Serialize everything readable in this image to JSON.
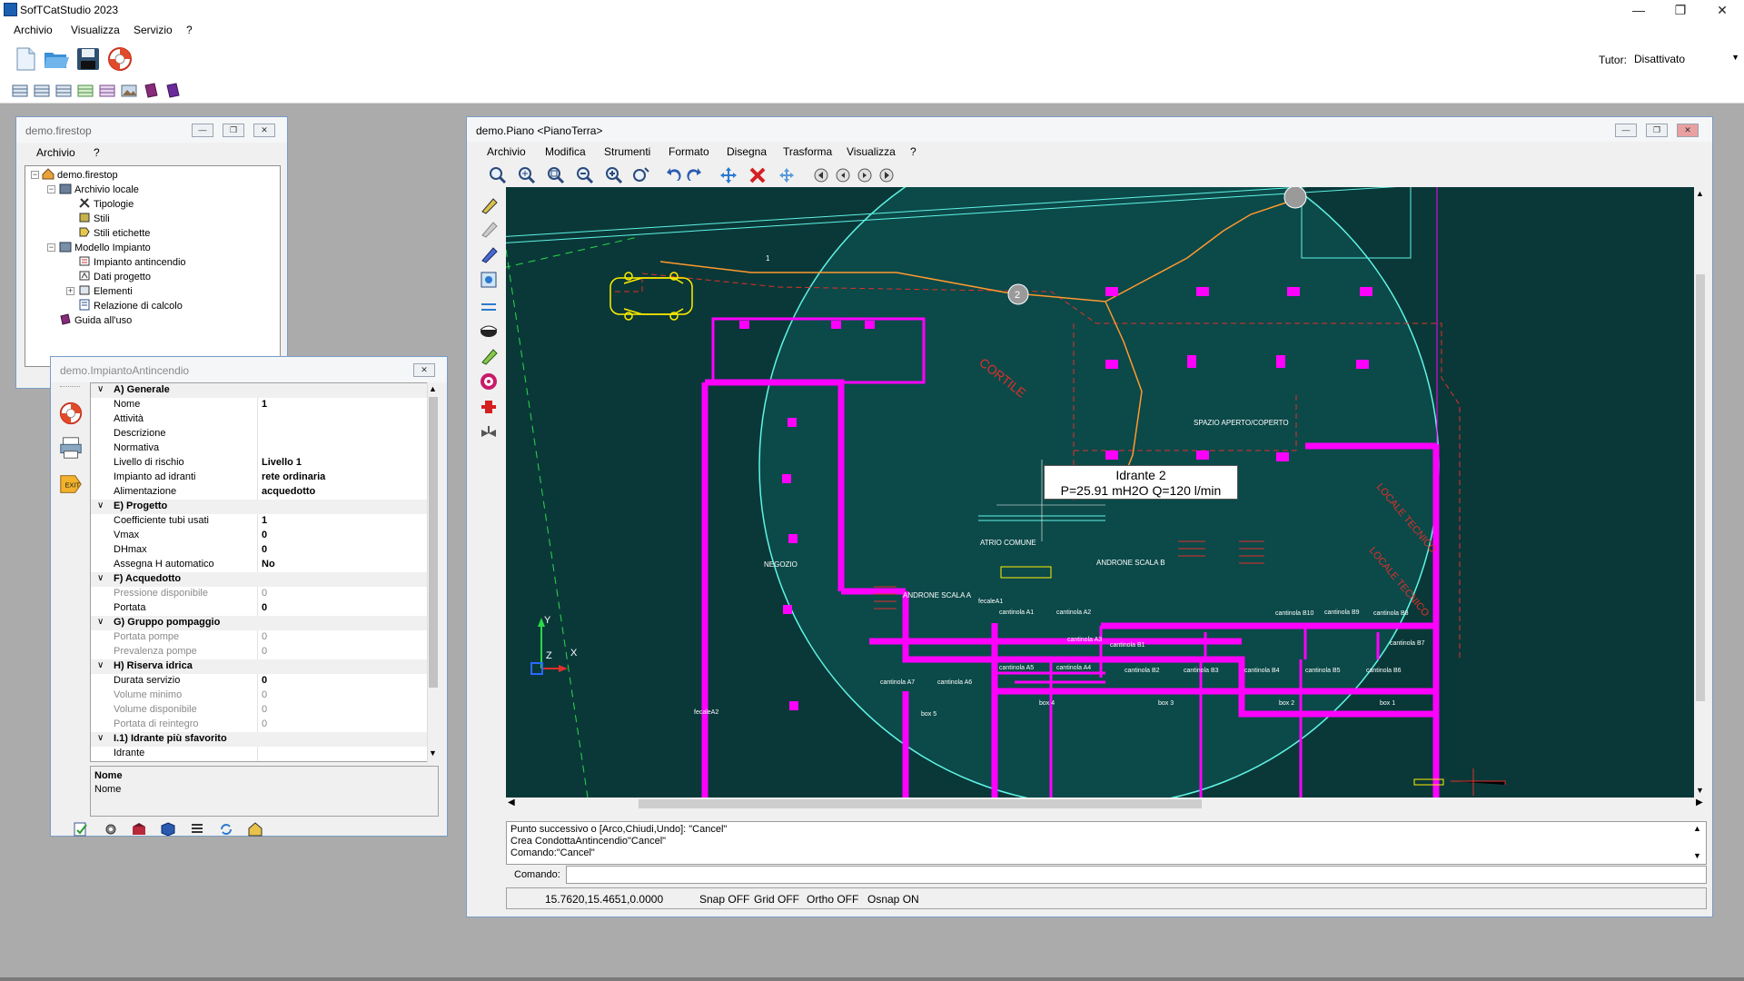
{
  "app": {
    "title": "SofTCatStudio 2023"
  },
  "menu": [
    "Archivio",
    "Visualizza",
    "Servizio",
    "?"
  ],
  "tutor": {
    "label": "Tutor:",
    "value": "Disattivato"
  },
  "firestop": {
    "title": "demo.firestop",
    "menu": [
      "Archivio",
      "?"
    ],
    "tree": [
      {
        "label": "demo.firestop"
      },
      {
        "label": "Archivio locale"
      },
      {
        "label": "Tipologie"
      },
      {
        "label": "Stili"
      },
      {
        "label": "Stili etichette"
      },
      {
        "label": "Modello Impianto"
      },
      {
        "label": "Impianto antincendio"
      },
      {
        "label": "Dati progetto"
      },
      {
        "label": "Elementi"
      },
      {
        "label": "Relazione di calcolo"
      },
      {
        "label": "Guida all'uso"
      }
    ]
  },
  "impianto": {
    "title": "demo.ImpiantoAntincendio",
    "rows": [
      {
        "type": "cat",
        "name": "A) Generale"
      },
      {
        "name": "Nome",
        "value": "1"
      },
      {
        "name": "Attività",
        "value": ""
      },
      {
        "name": "Descrizione",
        "value": ""
      },
      {
        "name": "Normativa",
        "value": ""
      },
      {
        "name": "Livello di rischio",
        "value": "Livello 1"
      },
      {
        "name": "Impianto ad idranti",
        "value": "rete ordinaria"
      },
      {
        "name": "Alimentazione",
        "value": "acquedotto"
      },
      {
        "type": "cat",
        "name": "E) Progetto"
      },
      {
        "name": "Coefficiente tubi usati",
        "value": "1"
      },
      {
        "name": "Vmax",
        "value": "0"
      },
      {
        "name": "DHmax",
        "value": "0"
      },
      {
        "name": "Assegna H automatico",
        "value": "No"
      },
      {
        "type": "cat",
        "name": "F) Acquedotto"
      },
      {
        "name": "Pressione disponibile",
        "value": "0",
        "grey": true
      },
      {
        "name": "Portata",
        "value": "0"
      },
      {
        "type": "cat",
        "name": "G) Gruppo pompaggio"
      },
      {
        "name": "Portata pompe",
        "value": "0",
        "grey": true
      },
      {
        "name": "Prevalenza pompe",
        "value": "0",
        "grey": true
      },
      {
        "type": "cat",
        "name": "H) Riserva idrica"
      },
      {
        "name": "Durata servizio",
        "value": "0"
      },
      {
        "name": "Volume minimo",
        "value": "0",
        "grey": true
      },
      {
        "name": "Volume disponibile",
        "value": "0",
        "grey": true
      },
      {
        "name": "Portata di reintegro",
        "value": "0",
        "grey": true
      },
      {
        "type": "cat",
        "name": "I.1) Idrante più sfavorito"
      },
      {
        "name": "Idrante",
        "value": ""
      }
    ],
    "desc_title": "Nome",
    "desc_text": "Nome"
  },
  "piano": {
    "title": "demo.Piano <PianoTerra>",
    "menu": [
      "Archivio",
      "Modifica",
      "Strumenti",
      "Formato",
      "Disegna",
      "Trasforma",
      "Visualizza",
      "?"
    ],
    "tooltip": {
      "line1": "Idrante 2",
      "line2": "P=25.91 mH2O Q=120 l/min"
    },
    "labels": {
      "cortile": "CORTILE",
      "spazio": "SPAZIO APERTO/COPERTO",
      "locale1": "LOCALE TECNICO",
      "locale2": "LOCALE TECNICO",
      "negozio": "NEGOZIO",
      "atrio": "ATRIO COMUNE",
      "androne_a": "ANDRONE SCALA A",
      "androne_b": "ANDRONE SCALA B",
      "cantine": [
        "cantinola A1",
        "cantinola A2",
        "cantinola A3",
        "cantinola A5",
        "cantinola A4",
        "cantinola A7",
        "cantinola A6",
        "cantinola B1",
        "cantinola B2",
        "cantinola B3",
        "cantinola B4",
        "cantinola B5",
        "cantinola B6",
        "cantinola B7",
        "cantinola B8",
        "cantinola B9",
        "cantinola B10"
      ],
      "boxes": [
        "box 5",
        "box 4",
        "box 3",
        "box 2",
        "box 1"
      ],
      "fecale1": "fecaleA1",
      "fecale2": "fecaleA2",
      "node1": "1",
      "node2": "2",
      "axis_y": "Y",
      "axis_z": "Z",
      "axis_x": "X"
    },
    "command_history": [
      "Punto successivo o [Arco,Chiudi,Undo]: \"Cancel\"",
      "Crea CondottaAntincendio\"Cancel\"",
      "Comando:\"Cancel\""
    ],
    "command_label": "Comando:",
    "status": {
      "coords": "15.7620,15.4651,0.0000",
      "snap": "Snap OFF",
      "grid": "Grid OFF",
      "ortho": "Ortho OFF",
      "osnap": "Osnap ON"
    }
  },
  "colors": {
    "magenta": "#ff00ff",
    "cyan": "#5ff5e6",
    "canvas_bg": "#0a3838",
    "red": "#e0302a",
    "orange": "#ff9a2e"
  }
}
